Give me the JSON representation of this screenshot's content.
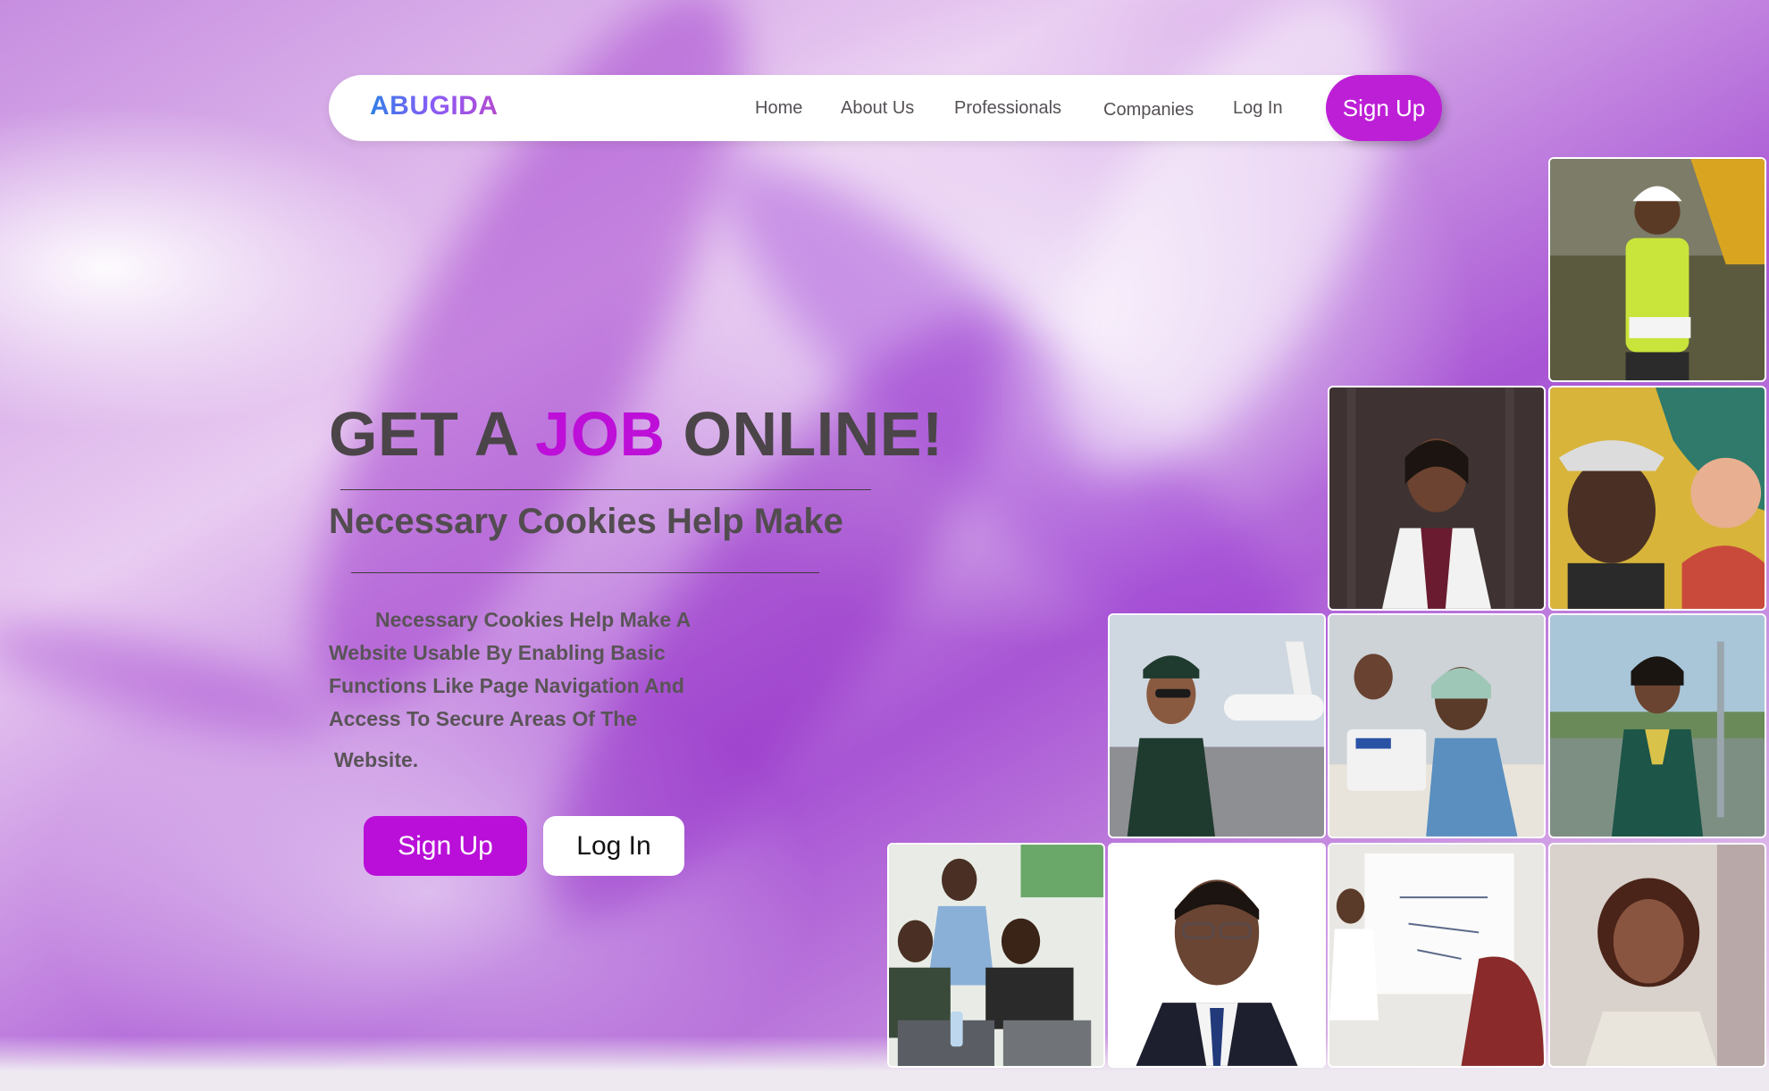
{
  "nav": {
    "brand": "ABUGIDA",
    "links": [
      "Home",
      "About Us",
      "Professionals",
      "Companies",
      "Log In"
    ],
    "signup_label": "Sign Up"
  },
  "hero": {
    "headline_pre": "GET A",
    "headline_accent": "JOB",
    "headline_post": "ONLINE!",
    "subheading": "Necessary Cookies Help Make",
    "paragraph": "Necessary Cookies Help Make A Website Usable By Enabling Basic Functions Like Page Navigation And Access To Secure Areas Of The",
    "paragraph_tail": "Website.",
    "signup_label": "Sign Up",
    "login_label": "Log In"
  },
  "colors": {
    "brand_purple": "#bd1fd6",
    "headline_accent": "#bd0fd8",
    "text_dark": "#4b4549"
  },
  "gallery": [
    {
      "name": "construction-worker-photo"
    },
    {
      "name": "doctor-photo"
    },
    {
      "name": "painter-photo"
    },
    {
      "name": "pilot-photo"
    },
    {
      "name": "seamstress-photo"
    },
    {
      "name": "flight-attendant-photo"
    },
    {
      "name": "workshop-team-photo"
    },
    {
      "name": "professional-portrait-photo"
    },
    {
      "name": "teacher-whiteboard-photo"
    },
    {
      "name": "businesswoman-photo"
    }
  ]
}
